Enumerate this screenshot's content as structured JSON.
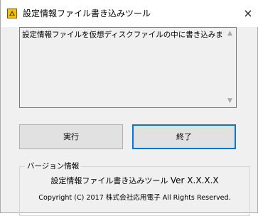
{
  "window": {
    "title": "設定情報ファイル書き込みツール",
    "close_glyph": "×",
    "icon_name": "app-icon"
  },
  "message_box": {
    "text": "設定情報ファイルを仮想ディスクファイルの中に書き込みます。",
    "scroll_up_glyph": "▲",
    "scroll_down_glyph": "▼"
  },
  "buttons": {
    "run_label": "実行",
    "exit_label": "終了"
  },
  "version_group": {
    "legend": "バージョン情報",
    "app_name": "設定情報ファイル書き込みツール",
    "version": "Ver X.X.X.X",
    "copyright": "Copyright (C) 2017 株式会社応用電子 All Rights Reserved."
  },
  "colors": {
    "window_bg": "#f0f0f0",
    "titlebar_bg": "#ffffff",
    "focus_border": "#0078d7",
    "button_bg": "#e1e1e1"
  }
}
